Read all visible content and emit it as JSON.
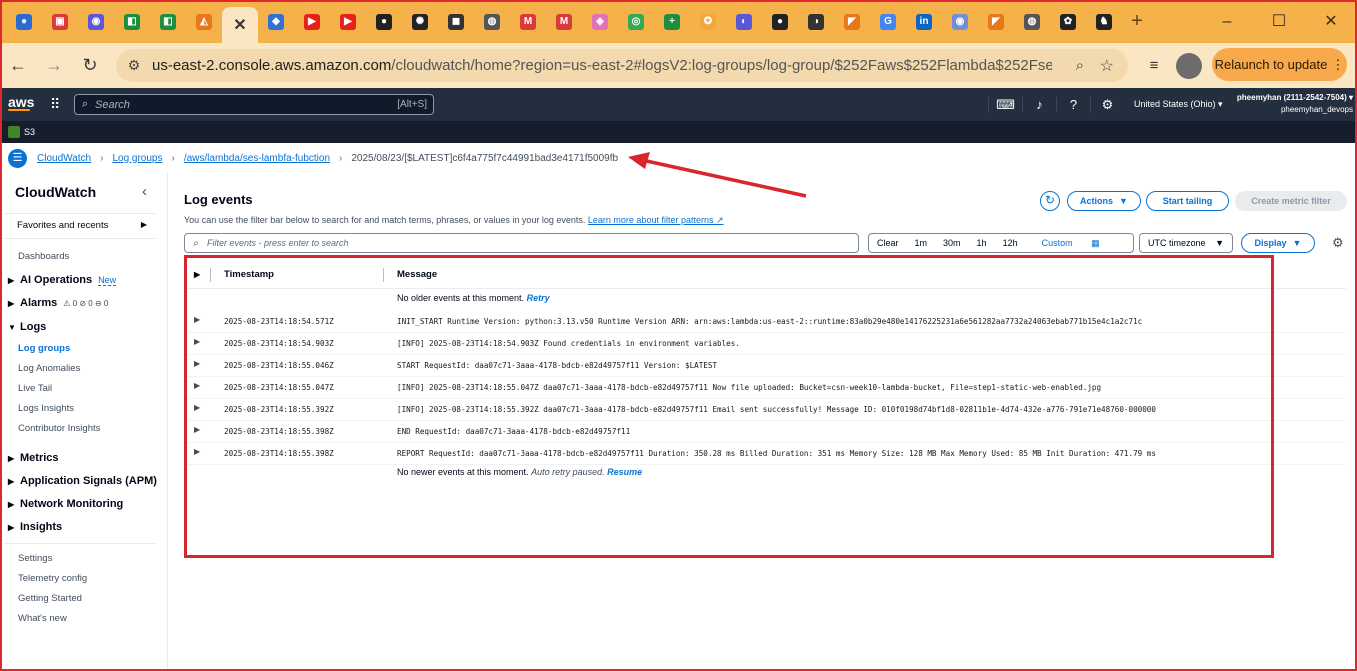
{
  "browser": {
    "tabs": [
      {
        "name": "tab-pinned-1",
        "glyph": "●",
        "color": "#2a6ad5"
      },
      {
        "name": "tab-pinned-2",
        "glyph": "▣",
        "color": "#d93a3a"
      },
      {
        "name": "tab-pinned-3",
        "glyph": "◉",
        "color": "#5a57d8"
      },
      {
        "name": "tab-pinned-4",
        "glyph": "◧",
        "color": "#1e8e3e"
      },
      {
        "name": "tab-pinned-5",
        "glyph": "◧",
        "color": "#1e8e3e"
      },
      {
        "name": "tab-pinned-6",
        "glyph": "◭",
        "color": "#e8761a"
      },
      {
        "name": "tab-active",
        "glyph": "✕",
        "color": "#333333",
        "active": true
      },
      {
        "name": "tab-8",
        "glyph": "◆",
        "color": "#3171d3"
      },
      {
        "name": "tab-youtube-1",
        "glyph": "▶",
        "color": "#e62117"
      },
      {
        "name": "tab-youtube-2",
        "glyph": "▶",
        "color": "#e62117"
      },
      {
        "name": "tab-github-1",
        "glyph": "●",
        "color": "#222222"
      },
      {
        "name": "tab-openai",
        "glyph": "✺",
        "color": "#222222"
      },
      {
        "name": "tab-13",
        "glyph": "◼",
        "color": "#333333"
      },
      {
        "name": "tab-14",
        "glyph": "◍",
        "color": "#555555"
      },
      {
        "name": "tab-gmail-1",
        "glyph": "M",
        "color": "#d93a3a"
      },
      {
        "name": "tab-gmail-2",
        "glyph": "M",
        "color": "#d93a3a"
      },
      {
        "name": "tab-17",
        "glyph": "◈",
        "color": "#e072b8"
      },
      {
        "name": "tab-18",
        "glyph": "◎",
        "color": "#34a853"
      },
      {
        "name": "tab-sheets",
        "glyph": "+",
        "color": "#1e8e3e"
      },
      {
        "name": "tab-20",
        "glyph": "✪",
        "color": "#f3a83c"
      },
      {
        "name": "tab-21",
        "glyph": "◐",
        "color": "#5a57d8"
      },
      {
        "name": "tab-github-2",
        "glyph": "●",
        "color": "#222222"
      },
      {
        "name": "tab-23",
        "glyph": "◑",
        "color": "#333333"
      },
      {
        "name": "tab-24",
        "glyph": "◤",
        "color": "#e8761a"
      },
      {
        "name": "tab-google",
        "glyph": "G",
        "color": "#4285f4"
      },
      {
        "name": "tab-linkedin",
        "glyph": "in",
        "color": "#0a66c2"
      },
      {
        "name": "tab-27",
        "glyph": "◉",
        "color": "#6f8fd8"
      },
      {
        "name": "tab-28",
        "glyph": "◤",
        "color": "#e8761a"
      },
      {
        "name": "tab-29",
        "glyph": "◍",
        "color": "#555555"
      },
      {
        "name": "tab-30",
        "glyph": "✿",
        "color": "#222222"
      },
      {
        "name": "tab-31",
        "glyph": "♞",
        "color": "#222222"
      }
    ],
    "new_tab": "+",
    "url_host": "us-east-2.console.aws.amazon.com",
    "url_rest": "/cloudwatch/home?region=us-east-2#logsV2:log-groups/log-group/$252Faws$252Flambda$252Fses-lambf...",
    "relaunch_label": "Relaunch to update"
  },
  "aws": {
    "logo": "aws",
    "search_placeholder": "Search",
    "search_shortcut": "[Alt+S]",
    "region": "United States (Ohio) ▾",
    "account_name": "pheemyhan (2111-2542-7504) ▾",
    "account_user": "pheemyhan_devops",
    "service_shortcut": "S3"
  },
  "breadcrumbs": {
    "items": [
      "CloudWatch",
      "Log groups",
      "/aws/lambda/ses-lambfa-fubction"
    ],
    "current": "2025/08/23/[$LATEST]c6f4a775f7c44991bad3e4171f5009fb"
  },
  "sidebar": {
    "title": "CloudWatch",
    "favorites": "Favorites and recents",
    "dashboards": "Dashboards",
    "ai_operations": "AI Operations",
    "new_tag": "New",
    "alarms": "Alarms",
    "alarm_counts": "⚠ 0   ⊘ 0   ⊖ 0",
    "logs": "Logs",
    "log_items": [
      "Log groups",
      "Log Anomalies",
      "Live Tail",
      "Logs Insights",
      "Contributor Insights"
    ],
    "sections": [
      "Metrics",
      "Application Signals (APM)",
      "Network Monitoring",
      "Insights"
    ],
    "footer_items": [
      "Settings",
      "Telemetry config",
      "Getting Started",
      "What's new"
    ]
  },
  "main": {
    "title": "Log events",
    "description": "You can use the filter bar below to search for and match terms, phrases, or values in your log events.",
    "learn_more": "Learn more about filter patterns",
    "actions_label": "Actions",
    "start_tailing_label": "Start tailing",
    "create_metric_filter_label": "Create metric filter",
    "filter_placeholder": "Filter events - press enter to search",
    "time_ranges": [
      "Clear",
      "1m",
      "30m",
      "1h",
      "12h"
    ],
    "custom_label": "Custom",
    "timezone": "UTC timezone",
    "display_label": "Display",
    "columns": [
      "Timestamp",
      "Message"
    ],
    "no_older": "No older events at this moment.",
    "retry": "Retry",
    "no_newer": "No newer events at this moment.",
    "auto_retry": "Auto retry paused.",
    "resume": "Resume",
    "rows": [
      {
        "ts": "2025-08-23T14:18:54.571Z",
        "msg": "INIT_START Runtime Version: python:3.13.v50 Runtime Version ARN: arn:aws:lambda:us-east-2::runtime:83a0b29e480e14176225231a6e561282aa7732a24063ebab771b15e4c1a2c71c"
      },
      {
        "ts": "2025-08-23T14:18:54.903Z",
        "msg": "[INFO] 2025-08-23T14:18:54.903Z Found credentials in environment variables."
      },
      {
        "ts": "2025-08-23T14:18:55.046Z",
        "msg": "START RequestId: daa07c71-3aaa-4178-bdcb-e82d49757f11 Version: $LATEST"
      },
      {
        "ts": "2025-08-23T14:18:55.047Z",
        "msg": "[INFO] 2025-08-23T14:18:55.047Z daa07c71-3aaa-4178-bdcb-e82d49757f11 Now file uploaded: Bucket=csn-week10-lambda-bucket, File=step1-static-web-enabled.jpg"
      },
      {
        "ts": "2025-08-23T14:18:55.392Z",
        "msg": "[INFO] 2025-08-23T14:18:55.392Z daa07c71-3aaa-4178-bdcb-e82d49757f11 Email sent successfully! Message ID: 010f0198d74bf1d8-02811b1e-4d74-432e-a776-791e71e48760-000000"
      },
      {
        "ts": "2025-08-23T14:18:55.398Z",
        "msg": "END RequestId: daa07c71-3aaa-4178-bdcb-e82d49757f11"
      },
      {
        "ts": "2025-08-23T14:18:55.398Z",
        "msg": "REPORT RequestId: daa07c71-3aaa-4178-bdcb-e82d49757f11 Duration: 350.28 ms Billed Duration: 351 ms Memory Size: 128 MB Max Memory Used: 85 MB Init Duration: 471.79 ms"
      }
    ]
  },
  "colors": {
    "annotation": "#d9262e",
    "accent": "#0972d3",
    "aws_bar": "#232f3e",
    "browser_tabbar": "#f6b24a"
  }
}
